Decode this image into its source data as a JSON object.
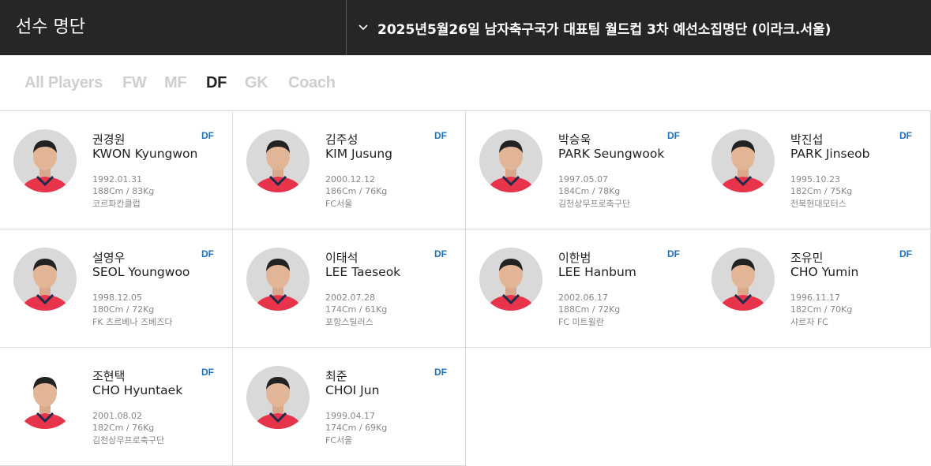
{
  "header": {
    "title": "선수 명단",
    "squad_select": "2025년5월26일 남자축구국가 대표팀 월드컵 3차 예선소집명단 (이라크.서울)"
  },
  "tabs": [
    {
      "label": "All Players",
      "active": false
    },
    {
      "label": "FW",
      "active": false
    },
    {
      "label": "MF",
      "active": false
    },
    {
      "label": "DF",
      "active": true
    },
    {
      "label": "GK",
      "active": false
    },
    {
      "label": "Coach",
      "active": false
    }
  ],
  "colors": {
    "header_bg": "#262626",
    "accent_position": "#1e73be",
    "tab_active": "#222222",
    "tab_inactive": "#cfcfcf",
    "kit_red": "#e8344a"
  },
  "players": [
    {
      "kname": "권경원",
      "ename": "KWON Kyungwon",
      "pos": "DF",
      "dob": "1992.01.31",
      "body": "188Cm / 83Kg",
      "club": "코르파칸클럽"
    },
    {
      "kname": "김주성",
      "ename": "KIM Jusung",
      "pos": "DF",
      "dob": "2000.12.12",
      "body": "186Cm / 76Kg",
      "club": "FC서울"
    },
    {
      "kname": "박승욱",
      "ename": "PARK Seungwook",
      "pos": "DF",
      "dob": "1997.05.07",
      "body": "184Cm / 78Kg",
      "club": "김천상무프로축구단"
    },
    {
      "kname": "박진섭",
      "ename": "PARK Jinseob",
      "pos": "DF",
      "dob": "1995.10.23",
      "body": "182Cm / 75Kg",
      "club": "전북현대모터스"
    },
    {
      "kname": "설영우",
      "ename": "SEOL Youngwoo",
      "pos": "DF",
      "dob": "1998.12.05",
      "body": "180Cm / 72Kg",
      "club": "FK 츠르베나 즈베즈다"
    },
    {
      "kname": "이태석",
      "ename": "LEE Taeseok",
      "pos": "DF",
      "dob": "2002.07.28",
      "body": "174Cm / 61Kg",
      "club": "포항스틸러스"
    },
    {
      "kname": "이한범",
      "ename": "LEE Hanbum",
      "pos": "DF",
      "dob": "2002.06.17",
      "body": "188Cm / 72Kg",
      "club": "FC 미트윌란"
    },
    {
      "kname": "조유민",
      "ename": "CHO Yumin",
      "pos": "DF",
      "dob": "1996.11.17",
      "body": "182Cm / 70Kg",
      "club": "샤르자 FC"
    },
    {
      "kname": "조현택",
      "ename": "CHO Hyuntaek",
      "pos": "DF",
      "dob": "2001.08.02",
      "body": "182Cm / 76Kg",
      "club": "김천상무프로축구단"
    },
    {
      "kname": "최준",
      "ename": "CHOI Jun",
      "pos": "DF",
      "dob": "1999.04.17",
      "body": "174Cm / 69Kg",
      "club": "FC서울"
    }
  ]
}
